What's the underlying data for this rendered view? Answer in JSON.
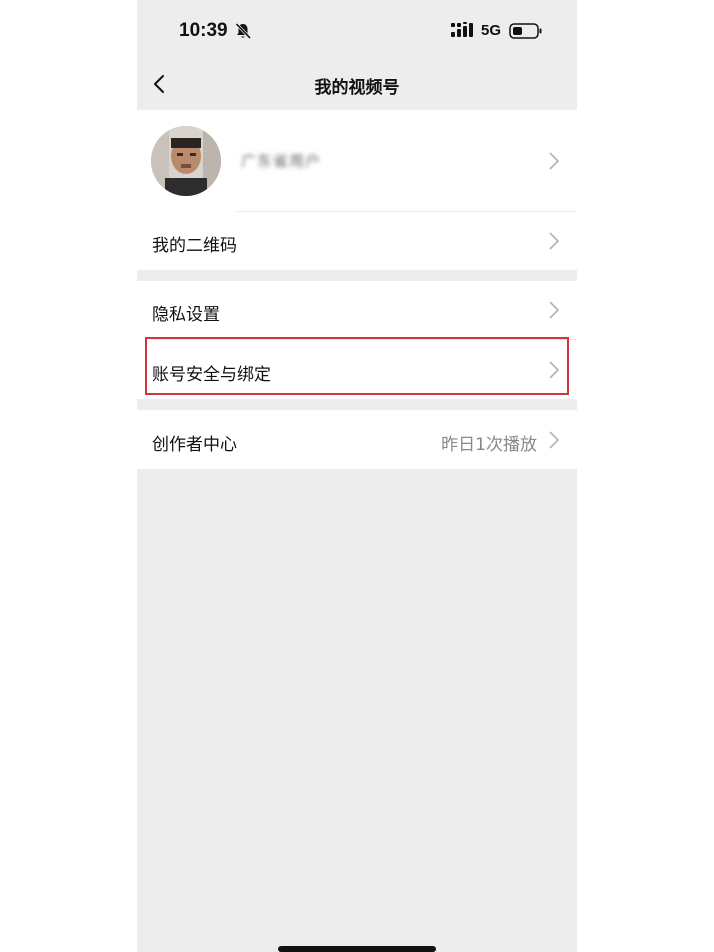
{
  "status_bar": {
    "time": "10:39",
    "network": "5G",
    "icons": [
      "bell-slash-icon",
      "signal-icon",
      "battery-icon"
    ]
  },
  "nav": {
    "title": "我的视频号",
    "back_icon": "chevron-left-icon"
  },
  "profile": {
    "name": "广东省用户",
    "avatar_icon": "avatar"
  },
  "menu": {
    "qrcode_label": "我的二维码",
    "privacy_label": "隐私设置",
    "account_security_label": "账号安全与绑定",
    "creator_center_label": "创作者中心",
    "creator_center_value": "昨日1次播放"
  },
  "colors": {
    "background": "#ededed",
    "card": "#ffffff",
    "highlight": "#d0343c",
    "secondary_text": "#888888"
  }
}
